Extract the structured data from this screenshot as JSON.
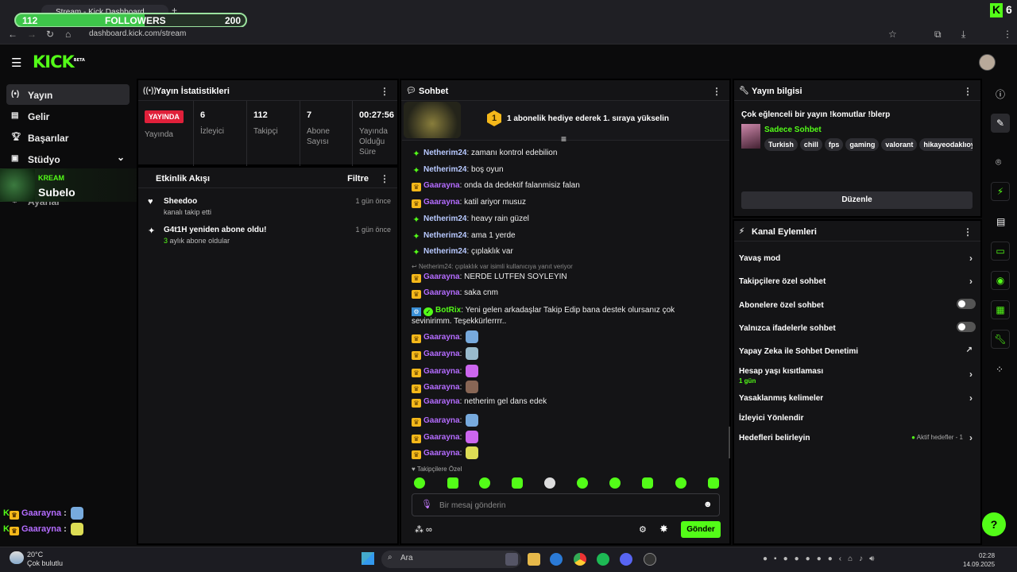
{
  "browser": {
    "tab_title": "Stream - Kick Dashboard",
    "url": "dashboard.kick.com/stream",
    "new_tab": "+"
  },
  "followers_bar": {
    "current": "112",
    "label": "FOLLOWERS",
    "goal": "200",
    "progress": 0.56
  },
  "kick_corner": {
    "number": "6"
  },
  "logo": {
    "text": "KICK",
    "beta": "BETA"
  },
  "sidebar": {
    "items": [
      {
        "label": "Yayın",
        "icon": "broadcast-icon"
      },
      {
        "label": "Gelir",
        "icon": "revenue-icon"
      },
      {
        "label": "Başarılar",
        "icon": "trophy-icon"
      },
      {
        "label": "Stüdyo",
        "icon": "studio-icon"
      },
      {
        "label": "Ayarlar",
        "icon": "settings-icon"
      }
    ]
  },
  "overlay": {
    "label": "KREAM",
    "name": "Subelo"
  },
  "side_chat": [
    {
      "user": "Gaarayna",
      "sep": ":"
    },
    {
      "user": "Gaarayna",
      "sep": ":"
    }
  ],
  "stats": {
    "title": "Yayın İstatistikleri",
    "live_badge": "YAYINDA",
    "live_label": "Yayında",
    "viewers": "6",
    "viewers_label": "İzleyici",
    "followers": "112",
    "followers_label": "Takipçi",
    "subs": "7",
    "subs_label": "Abone Sayısı",
    "uptime": "00:27:56",
    "uptime_label": "Yayında Olduğu Süre"
  },
  "activity": {
    "title": "Etkinlik Akışı",
    "filter": "Filtre",
    "items": [
      {
        "title": "Sheedoo",
        "sub": "kanalı takip etti",
        "time": "1 gün önce"
      },
      {
        "title": "G4t1H yeniden abone oldu!",
        "sub_num": "3",
        "sub": "aylık abone oldular",
        "time": "1 gün önce"
      }
    ]
  },
  "chat": {
    "title": "Sohbet",
    "gift_num": "1",
    "gift_text": "1 abonelik hediye ederek 1. sıraya yükselin",
    "messages": [
      {
        "badge": "vip",
        "user": "Netherim24",
        "color": "#b8c9ff",
        "text": "zamanı kontrol edebilion"
      },
      {
        "badge": "vip",
        "user": "Netherim24",
        "color": "#b8c9ff",
        "text": "boş oyun"
      },
      {
        "badge": "sub",
        "user": "Gaarayna",
        "color": "#b46cff",
        "text": "onda da dedektif falanmisiz falan"
      },
      {
        "badge": "sub",
        "user": "Gaarayna",
        "color": "#b46cff",
        "text": "katil ariyor musuz"
      },
      {
        "badge": "vip",
        "user": "Netherim24",
        "color": "#b8c9ff",
        "text": "heavy rain güzel"
      },
      {
        "badge": "vip",
        "user": "Netherim24",
        "color": "#b8c9ff",
        "text": "ama 1 yerde"
      },
      {
        "badge": "vip",
        "user": "Netherim24",
        "color": "#b8c9ff",
        "text": "çıplaklık var"
      }
    ],
    "reply_note": "Netherim24: çıplaklık var isimli kullanıcıya yanıt veriyor",
    "messages2": [
      {
        "user": "Gaarayna",
        "text": "NERDE LUTFEN SOYLEYIN"
      },
      {
        "user": "Gaarayna",
        "text": "saka cnm"
      }
    ],
    "botrix": {
      "user": "BotRix",
      "line1": "Yeni gelen arkadaşlar Takip Edip bana destek olursanız çok sevinirimm.",
      "line2": "Teşekkürlerrrr.."
    },
    "emote_msgs": [
      {
        "user": "Gaarayna"
      },
      {
        "user": "Gaarayna"
      },
      {
        "user": "Gaarayna"
      },
      {
        "user": "Gaarayna"
      }
    ],
    "last_msgs": [
      {
        "user": "Gaarayna",
        "text": "netherim gel dans edek"
      }
    ],
    "emote_msgs2": [
      {
        "user": "Gaarayna"
      },
      {
        "user": "Gaarayna"
      },
      {
        "user": "Gaarayna"
      }
    ],
    "followers_only": "Takipçilere Özel",
    "input_placeholder": "Bir mesaj gönderin",
    "send": "Gönder"
  },
  "stream_info": {
    "title": "Yayın bilgisi",
    "stream_title": "Çok eğlenceli bir yayın !komutlar !blerp",
    "category": "Sadece Sohbet",
    "tags": [
      "Turkish",
      "chill",
      "fps",
      "gaming",
      "valorant",
      "hikayeodaklıoyu"
    ],
    "edit": "Düzenle"
  },
  "channel_actions": {
    "title": "Kanal Eylemleri",
    "rows": [
      {
        "label": "Yavaş mod"
      },
      {
        "label": "Takipçilere özel sohbet"
      },
      {
        "label": "Abonelere özel sohbet"
      },
      {
        "label": "Yalnızca ifadelerle sohbet"
      },
      {
        "label": "Yapay Zeka ile Sohbet Denetimi"
      },
      {
        "label": "Hesap yaşı kısıtlaması",
        "sub": "1 gün"
      },
      {
        "label": "Yasaklanmış kelimeler"
      },
      {
        "label": "İzleyici Yönlendir"
      },
      {
        "label": "Hedefleri belirleyin",
        "right": "Aktif hedefler - 1"
      }
    ]
  },
  "taskbar": {
    "temp": "20°C",
    "weather": "Çok bulutlu",
    "search": "Ara",
    "time": "02:28",
    "date": "14.09.2025"
  }
}
